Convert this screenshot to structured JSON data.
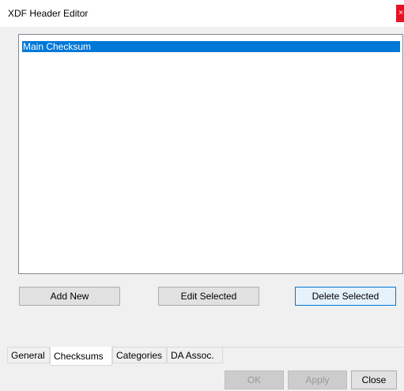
{
  "window": {
    "title": "XDF Header Editor",
    "close_glyph": "×"
  },
  "listbox": {
    "items": [
      {
        "label": "Main Checksum",
        "selected": true
      }
    ]
  },
  "actions": {
    "add_new": "Add New",
    "edit_selected": "Edit Selected",
    "delete_selected": "Delete Selected"
  },
  "tabs": [
    {
      "label": "General",
      "active": false
    },
    {
      "label": "Checksums",
      "active": true
    },
    {
      "label": "Categories",
      "active": false
    },
    {
      "label": "DA Assoc.",
      "active": false
    }
  ],
  "dialog_buttons": {
    "ok": "OK",
    "apply": "Apply",
    "close": "Close"
  },
  "colors": {
    "selection": "#0078d7",
    "close_button": "#e81123",
    "panel_background": "#f0f0f0"
  }
}
